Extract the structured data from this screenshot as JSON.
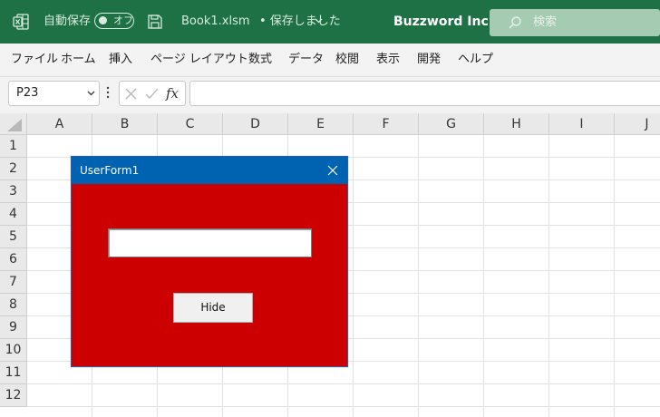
{
  "titlebar": {
    "autosave_label": "自動保存",
    "autosave_state": "オフ",
    "filename": "Book1.xlsm",
    "save_status": "• 保存しました",
    "company": "Buzzword Inc.",
    "search_placeholder": "検索",
    "brand_color": "#1e7145"
  },
  "ribbon": {
    "tabs": [
      "ファイル",
      "ホーム",
      "挿入",
      "ページ レイアウト",
      "数式",
      "データ",
      "校閲",
      "表示",
      "開発",
      "ヘルプ"
    ]
  },
  "formula_bar": {
    "name_box": "P23",
    "fx_label": "fx",
    "formula": ""
  },
  "grid": {
    "columns": [
      "A",
      "B",
      "C",
      "D",
      "E",
      "F",
      "G",
      "H",
      "I",
      "J"
    ],
    "rows": [
      "1",
      "2",
      "3",
      "4",
      "5",
      "6",
      "7",
      "8",
      "9",
      "10",
      "11",
      "12"
    ]
  },
  "userform": {
    "title": "UserForm1",
    "textbox_value": "",
    "button_label": "Hide",
    "background_color": "#cc0000",
    "titlebar_color": "#0063b1"
  },
  "icons": [
    "excel-icon",
    "save-icon",
    "chevron-down-icon",
    "search-icon",
    "cancel-icon",
    "enter-icon",
    "fx-icon",
    "close-icon",
    "select-all-icon"
  ]
}
